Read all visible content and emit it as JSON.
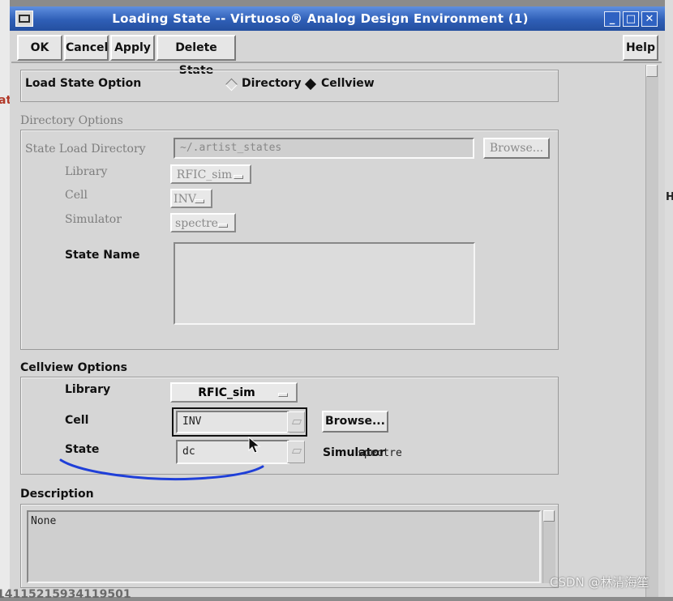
{
  "window": {
    "title": "Loading State -- Virtuoso® Analog Design Environment (1)"
  },
  "titlebar_buttons": {
    "minimize": "_",
    "maximize": "□",
    "close": "✕"
  },
  "toolbar": {
    "ok": "OK",
    "cancel": "Cancel",
    "apply": "Apply",
    "delete_state": "Delete State",
    "help": "Help"
  },
  "load_state_option": {
    "label": "Load State Option",
    "options": [
      "Directory",
      "Cellview"
    ],
    "selected": "Cellview"
  },
  "directory_options": {
    "heading": "Directory Options",
    "dir_label": "State Load Directory",
    "dir_value": "~/.artist_states",
    "browse": "Browse...",
    "library_label": "Library",
    "library_value": "RFIC_sim",
    "cell_label": "Cell",
    "cell_value": "INV",
    "simulator_label": "Simulator",
    "simulator_value": "spectre",
    "state_name_label": "State Name"
  },
  "cellview_options": {
    "heading": "Cellview Options",
    "library_label": "Library",
    "library_value": "RFIC_sim",
    "cell_label": "Cell",
    "cell_value": "INV",
    "browse": "Browse...",
    "state_label": "State",
    "state_value": "dc",
    "simulator_label": "Simulator",
    "simulator_value": "spectre"
  },
  "description": {
    "heading": "Description",
    "text": "None"
  },
  "background": {
    "left_fragment": "ate",
    "bottom_fragment": "14115215934119501",
    "right_letter": "H"
  },
  "watermark": "CSDN @林清海笙",
  "colors": {
    "title_bar": "#2f5fb7",
    "panel_bg": "#d6d6d6",
    "annotation_blue": "#1f3fd8",
    "left_fragment_red": "#b23a2a"
  }
}
